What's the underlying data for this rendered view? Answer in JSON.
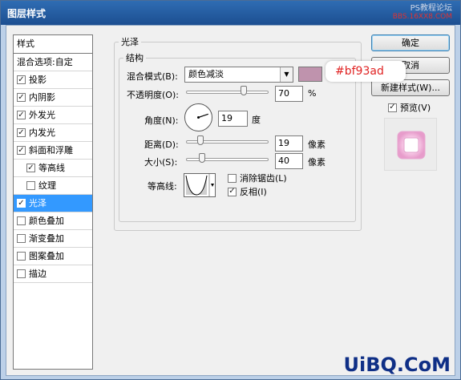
{
  "window": {
    "title": "图层样式",
    "watermark_top_line1": "PS教程论坛",
    "watermark_top_line2": "BBS.16XX8.COM",
    "watermark_bottom": "UiBQ.CoM"
  },
  "styles_panel": {
    "header": "样式",
    "blend_options": "混合选项:自定",
    "items": [
      {
        "label": "投影",
        "checked": true,
        "sub": false,
        "selected": false
      },
      {
        "label": "内阴影",
        "checked": true,
        "sub": false,
        "selected": false
      },
      {
        "label": "外发光",
        "checked": true,
        "sub": false,
        "selected": false
      },
      {
        "label": "内发光",
        "checked": true,
        "sub": false,
        "selected": false
      },
      {
        "label": "斜面和浮雕",
        "checked": true,
        "sub": false,
        "selected": false
      },
      {
        "label": "等高线",
        "checked": true,
        "sub": true,
        "selected": false
      },
      {
        "label": "纹理",
        "checked": false,
        "sub": true,
        "selected": false
      },
      {
        "label": "光泽",
        "checked": true,
        "sub": false,
        "selected": true
      },
      {
        "label": "颜色叠加",
        "checked": false,
        "sub": false,
        "selected": false
      },
      {
        "label": "渐变叠加",
        "checked": false,
        "sub": false,
        "selected": false
      },
      {
        "label": "图案叠加",
        "checked": false,
        "sub": false,
        "selected": false
      },
      {
        "label": "描边",
        "checked": false,
        "sub": false,
        "selected": false
      }
    ]
  },
  "satin": {
    "group_title": "光泽",
    "structure_title": "结构",
    "blend_mode_label": "混合模式(B):",
    "blend_mode_value": "颜色减淡",
    "swatch_color": "#bf93ad",
    "color_badge": "#bf93ad",
    "opacity_label": "不透明度(O):",
    "opacity_value": "70",
    "opacity_unit": "%",
    "opacity_level": 0.7,
    "angle_label": "角度(N):",
    "angle_value": "19",
    "angle_unit": "度",
    "distance_label": "距离(D):",
    "distance_value": "19",
    "distance_unit": "像素",
    "size_label": "大小(S):",
    "size_value": "40",
    "size_unit": "像素",
    "contour_label": "等高线:",
    "anti_alias_label": "消除锯齿(L)",
    "anti_alias_checked": false,
    "invert_label": "反相(I)",
    "invert_checked": true
  },
  "buttons": {
    "ok": "确定",
    "cancel": "取消",
    "new_style": "新建样式(W)...",
    "preview_label": "预览(V)",
    "preview_checked": true
  }
}
